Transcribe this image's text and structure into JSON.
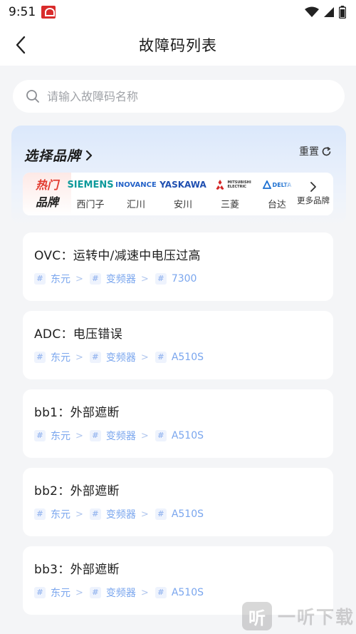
{
  "status": {
    "time": "9:51"
  },
  "header": {
    "title": "故障码列表"
  },
  "search": {
    "placeholder": "请输入故障码名称"
  },
  "brand_section": {
    "title": "选择品牌",
    "reset_label": "重置",
    "hot_label_top": "热门",
    "hot_label_bottom": "品牌",
    "brands": [
      {
        "logo": "SIEMENS",
        "name": "西门子",
        "color": "#0d9a9b"
      },
      {
        "logo": "INOVANCE",
        "name": "汇川",
        "color": "#2563c9"
      },
      {
        "logo": "YASKAWA",
        "name": "安川",
        "color": "#1f4fb0"
      },
      {
        "logo": "MITSUBISHI ELECTRIC",
        "name": "三菱",
        "color": "#d42525"
      },
      {
        "logo": "DELTA",
        "name": "台达",
        "color": "#1a6fd1"
      }
    ],
    "more_label": "更多品牌"
  },
  "faults": [
    {
      "title": "OVC：运转中/减速中电压过高",
      "brand": "东元",
      "category": "变频器",
      "model": "7300"
    },
    {
      "title": "ADC：电压错误",
      "brand": "东元",
      "category": "变频器",
      "model": "A510S"
    },
    {
      "title": "bb1：外部遮断",
      "brand": "东元",
      "category": "变频器",
      "model": "A510S"
    },
    {
      "title": "bb2：外部遮断",
      "brand": "东元",
      "category": "变频器",
      "model": "A510S"
    },
    {
      "title": "bb3：外部遮断",
      "brand": "东元",
      "category": "变频器",
      "model": "A510S"
    }
  ],
  "watermark": {
    "icon_char": "听",
    "text": "一听下载"
  }
}
